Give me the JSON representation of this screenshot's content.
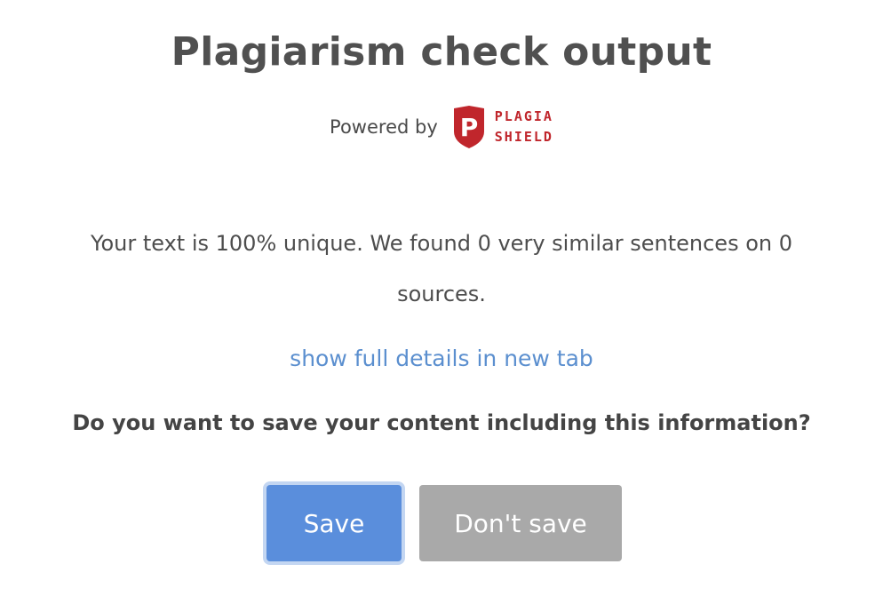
{
  "dialog": {
    "title": "Plagiarism check output",
    "powered_by": "Powered by",
    "logo": {
      "icon": "plagiashield-shield-logo",
      "icon_letter": "P",
      "line1": "PLAGIA",
      "line2": "SHIELD",
      "brand_color": "#c0262c"
    },
    "message": "Your text is 100% unique. We found 0 very similar sentences on 0 sources.",
    "details_link": "show full details in new tab",
    "question": "Do you want to save your content including this information?",
    "buttons": {
      "save": "Save",
      "dont_save": "Don't save"
    },
    "colors": {
      "save_button": "#5a8edc",
      "dont_save_button": "#a9a9a9",
      "link": "#5b8fcf"
    }
  }
}
